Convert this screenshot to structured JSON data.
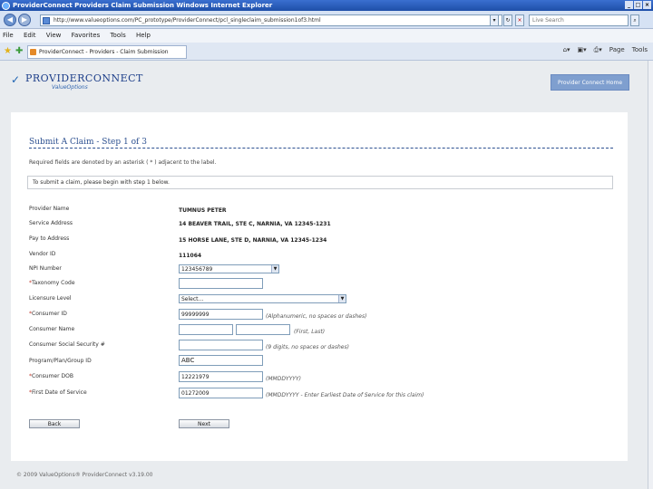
{
  "window": {
    "title": "ProviderConnect   Providers   Claim Submission   Windows Internet Explorer"
  },
  "browser": {
    "address": "http://www.valueoptions.com/PC_prototype/ProviderConnect/pcl_singleclaim_submission1of3.html",
    "search_placeholder": "Live Search",
    "menu": [
      "File",
      "Edit",
      "View",
      "Favorites",
      "Tools",
      "Help"
    ],
    "tab_title": "ProviderConnect - Providers - Claim Submission",
    "tools": [
      "Page",
      "Tools"
    ]
  },
  "brand": {
    "name": "PROVIDERCONNECT",
    "sub": "ValueOptions",
    "home_button": "Provider Connect Home"
  },
  "form": {
    "title": "Submit A Claim - Step 1 of 3",
    "required_note": "Required fields are denoted by an asterisk ( * ) adjacent to the label.",
    "info": "To submit a claim, please begin with step 1 below.",
    "fields": {
      "provider_name": {
        "label": "Provider Name",
        "value": "TUMNUS PETER"
      },
      "service_address": {
        "label": "Service Address",
        "value": "14 BEAVER TRAIL, STE C, NARNIA, VA 12345-1231"
      },
      "pay_to_address": {
        "label": "Pay to Address",
        "value": "15 HORSE LANE, STE D, NARNIA, VA 12345-1234"
      },
      "vendor_id": {
        "label": "Vendor ID",
        "value": "111064"
      },
      "npi_number": {
        "label": "NPI Number",
        "value": "123456789"
      },
      "taxonomy_code": {
        "label": "Taxonomy Code",
        "value": ""
      },
      "licensure_level": {
        "label": "Licensure Level",
        "value": "Select..."
      },
      "consumer_id": {
        "label": "Consumer ID",
        "value": "99999999",
        "hint": "(Alphanumeric, no spaces or dashes)"
      },
      "consumer_name": {
        "label": "Consumer Name",
        "first": "",
        "last": "",
        "hint": "(First, Last)"
      },
      "consumer_ssn": {
        "label": "Consumer Social Security #",
        "value": "",
        "hint": "(9 digits, no spaces or dashes)"
      },
      "program": {
        "label": "Program/Plan/Group ID",
        "value": "ABC"
      },
      "consumer_dob": {
        "label": "Consumer DOB",
        "value": "12221979",
        "hint": "(MMDDYYYY)"
      },
      "first_date": {
        "label": "First Date of Service",
        "value": "01272009",
        "hint": "(MMDDYYYY - Enter Earliest Date of Service for this claim)"
      }
    },
    "back": "Back",
    "next": "Next"
  },
  "footer": "© 2009 ValueOptions® ProviderConnect v3.19.00"
}
